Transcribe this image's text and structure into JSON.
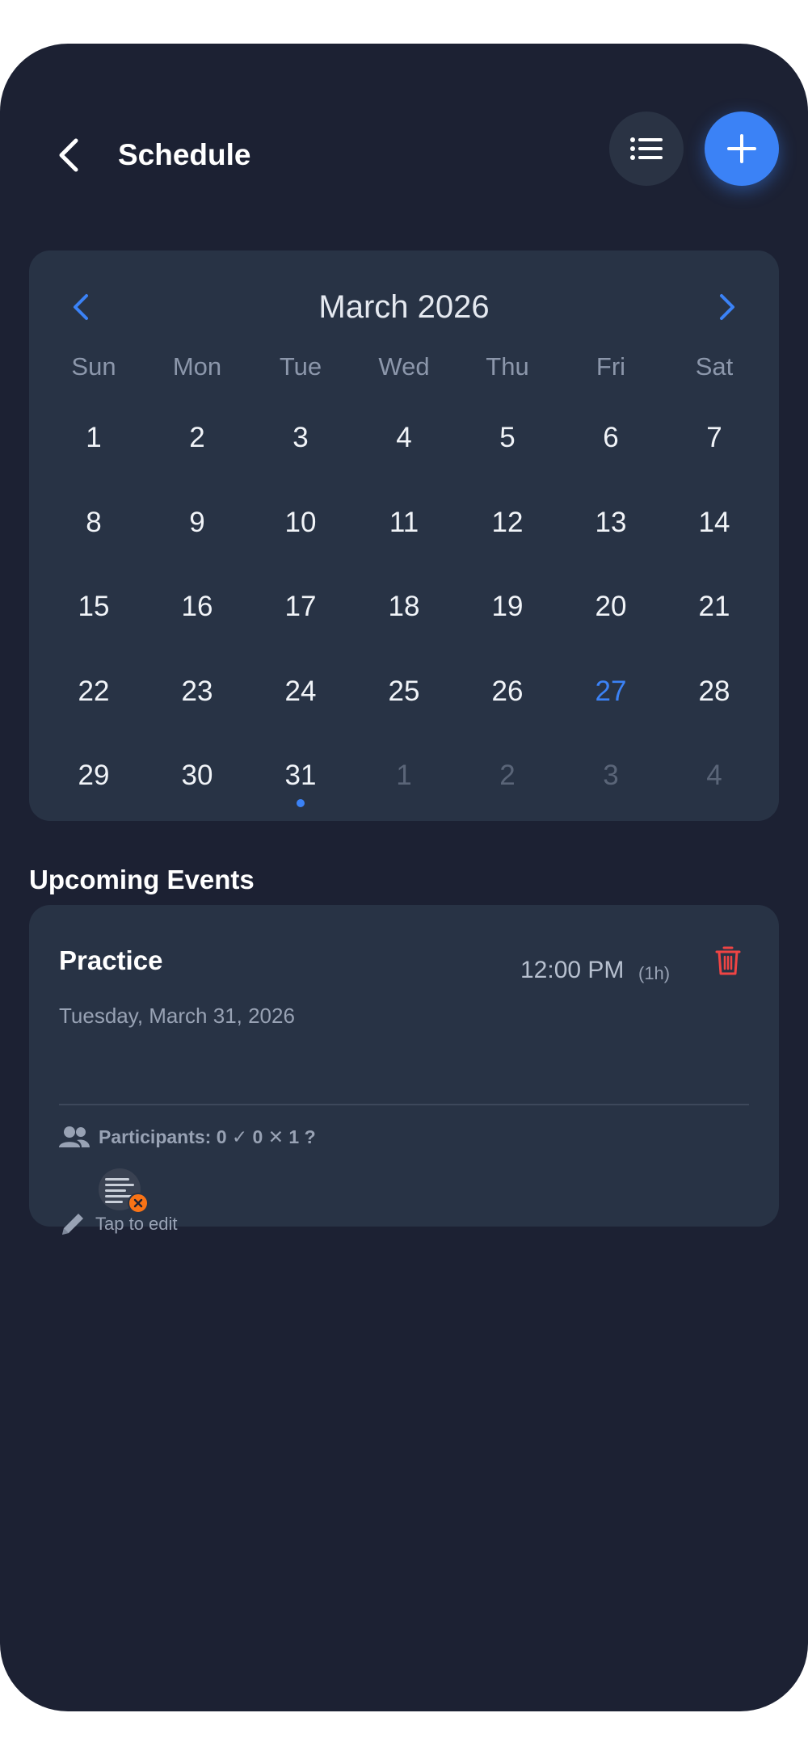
{
  "header": {
    "title": "Schedule",
    "back_icon": "chevron-left-icon",
    "list_icon": "list-icon",
    "add_icon": "plus-icon"
  },
  "calendar": {
    "month_label": "March 2026",
    "weekdays": [
      "Sun",
      "Mon",
      "Tue",
      "Wed",
      "Thu",
      "Fri",
      "Sat"
    ],
    "days": [
      {
        "label": "1",
        "muted": false
      },
      {
        "label": "2",
        "muted": false
      },
      {
        "label": "3",
        "muted": false
      },
      {
        "label": "4",
        "muted": false
      },
      {
        "label": "5",
        "muted": false
      },
      {
        "label": "6",
        "muted": false
      },
      {
        "label": "7",
        "muted": false
      },
      {
        "label": "8",
        "muted": false
      },
      {
        "label": "9",
        "muted": false
      },
      {
        "label": "10",
        "muted": false
      },
      {
        "label": "11",
        "muted": false
      },
      {
        "label": "12",
        "muted": false
      },
      {
        "label": "13",
        "muted": false
      },
      {
        "label": "14",
        "muted": false
      },
      {
        "label": "15",
        "muted": false
      },
      {
        "label": "16",
        "muted": false
      },
      {
        "label": "17",
        "muted": false
      },
      {
        "label": "18",
        "muted": false
      },
      {
        "label": "19",
        "muted": false
      },
      {
        "label": "20",
        "muted": false
      },
      {
        "label": "21",
        "muted": false
      },
      {
        "label": "22",
        "muted": false
      },
      {
        "label": "23",
        "muted": false
      },
      {
        "label": "24",
        "muted": false
      },
      {
        "label": "25",
        "muted": false
      },
      {
        "label": "26",
        "muted": false
      },
      {
        "label": "27",
        "muted": false,
        "today": true
      },
      {
        "label": "28",
        "muted": false
      },
      {
        "label": "29",
        "muted": false
      },
      {
        "label": "30",
        "muted": false
      },
      {
        "label": "31",
        "muted": false,
        "has_event": true
      },
      {
        "label": "1",
        "muted": true
      },
      {
        "label": "2",
        "muted": true
      },
      {
        "label": "3",
        "muted": true
      },
      {
        "label": "4",
        "muted": true
      }
    ],
    "accent_color": "#3b82f6"
  },
  "upcoming": {
    "section_title": "Upcoming Events",
    "events": [
      {
        "name": "Practice",
        "time": "12:00 PM",
        "duration": "(1h)",
        "date": "Tuesday, March 31, 2026",
        "participants": "Participants: 0 ✓  0 ✕  1 ?",
        "edit_hint": "Tap to edit"
      }
    ]
  },
  "colors": {
    "background": "#1c2133",
    "card": "#283345",
    "accent": "#3b82f6",
    "delete": "#ef4444",
    "badge": "#f97316"
  }
}
